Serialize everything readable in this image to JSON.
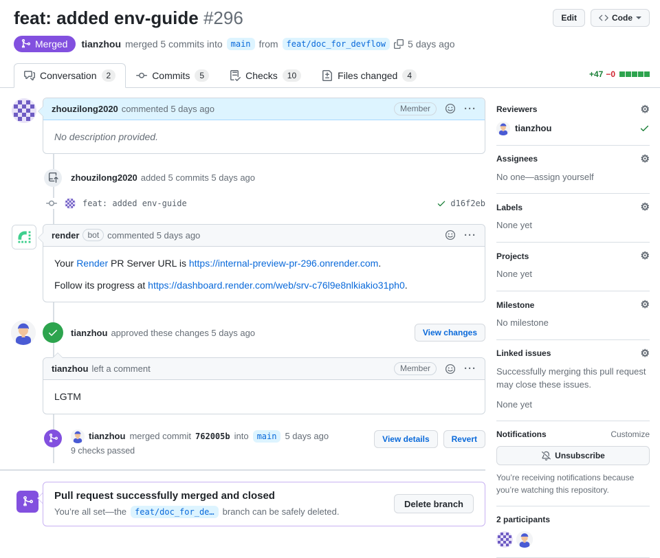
{
  "header": {
    "title": "feat: added env-guide",
    "number": "#296",
    "edit_button": "Edit",
    "code_button": "Code"
  },
  "meta": {
    "status": "Merged",
    "author": "tianzhou",
    "action": "merged 5 commits into",
    "base_branch": "main",
    "from_word": "from",
    "head_branch": "feat/doc_for_devflow",
    "time": "5 days ago"
  },
  "tabs": [
    {
      "label": "Conversation",
      "count": "2"
    },
    {
      "label": "Commits",
      "count": "5"
    },
    {
      "label": "Checks",
      "count": "10"
    },
    {
      "label": "Files changed",
      "count": "4"
    }
  ],
  "diffstat": {
    "additions": "+47",
    "deletions": "−0",
    "blocks": 5
  },
  "timeline": {
    "comment1": {
      "author": "zhouzilong2020",
      "action": "commented 5 days ago",
      "badge": "Member",
      "body": "No description provided."
    },
    "push_event": {
      "author": "zhouzilong2020",
      "action": "added 5 commits 5 days ago"
    },
    "commit": {
      "message": "feat: added env-guide",
      "sha": "d16f2eb"
    },
    "render_comment": {
      "author": "render",
      "bot_badge": "bot",
      "action": "commented 5 days ago",
      "p1_pre": "Your ",
      "p1_link1": "Render",
      "p1_mid": " PR Server URL is ",
      "p1_link2": "https://internal-preview-pr-296.onrender.com",
      "p1_end": ".",
      "p2_pre": "Follow its progress at ",
      "p2_link": "https://dashboard.render.com/web/srv-c76l9e8nlkiakio31ph0",
      "p2_end": "."
    },
    "approval": {
      "author": "tianzhou",
      "action": "approved these changes 5 days ago",
      "button": "View changes"
    },
    "review_comment": {
      "author": "tianzhou",
      "action": "left a comment",
      "badge": "Member",
      "body": "LGTM"
    },
    "merge_event": {
      "author": "tianzhou",
      "action": "merged commit",
      "sha": "762005b",
      "into_word": "into",
      "branch": "main",
      "time": "5 days ago",
      "checks_note": "9 checks passed",
      "details_button": "View details",
      "revert_button": "Revert"
    },
    "merged_box": {
      "title": "Pull request successfully merged and closed",
      "body_pre": "You’re all set—the",
      "branch": "feat/doc_for_de…",
      "body_post": "branch can be safely deleted.",
      "button": "Delete branch"
    }
  },
  "sidebar": {
    "reviewers": {
      "title": "Reviewers",
      "reviewer": "tianzhou"
    },
    "assignees": {
      "title": "Assignees",
      "empty_pre": "No one—",
      "assign_link": "assign yourself"
    },
    "labels": {
      "title": "Labels",
      "empty": "None yet"
    },
    "projects": {
      "title": "Projects",
      "empty": "None yet"
    },
    "milestone": {
      "title": "Milestone",
      "empty": "No milestone"
    },
    "linked_issues": {
      "title": "Linked issues",
      "desc": "Successfully merging this pull request may close these issues.",
      "empty": "None yet"
    },
    "notifications": {
      "title": "Notifications",
      "customize": "Customize",
      "button": "Unsubscribe",
      "desc": "You’re receiving notifications because you’re watching this repository."
    },
    "participants": {
      "title": "2 participants"
    }
  },
  "icons": {
    "git-merge": "merge glyph",
    "check": "checkmark",
    "comment-discussion": "speech bubbles",
    "git-commit": "commit node",
    "checklist": "checks list",
    "file-diff": "file with diff",
    "repo-push": "push arrow",
    "code": "angle brackets",
    "copy": "two squares",
    "smiley": "smiley face",
    "kebab": "horizontal dots",
    "gear": "settings gear",
    "bell-slash": "muted bell"
  },
  "colors": {
    "merged": "#8250df",
    "link": "#0969da",
    "success": "#1a7f37",
    "danger": "#cf222e",
    "accent_bg": "#ddf4ff"
  }
}
